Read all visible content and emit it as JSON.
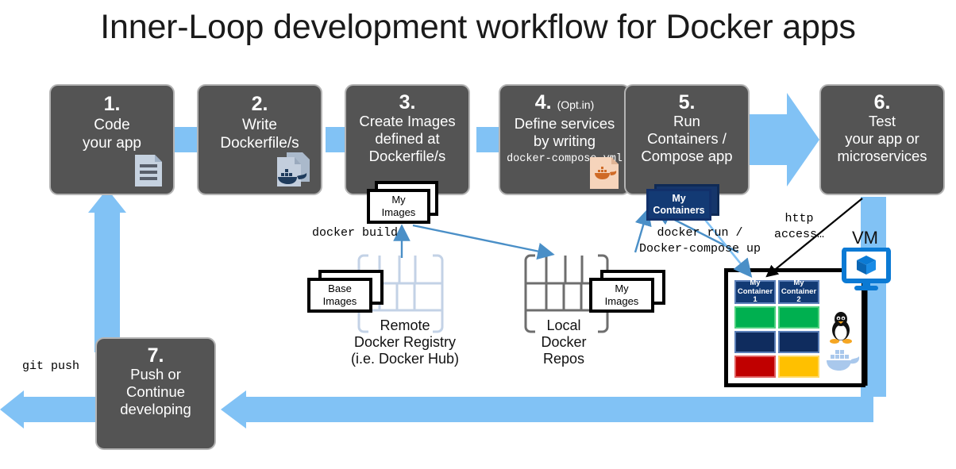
{
  "title": "Inner-Loop development workflow for Docker apps",
  "steps": [
    {
      "num": "1.",
      "opt": "",
      "lines": [
        "Code",
        "your app"
      ],
      "mono": "",
      "icon": "document-icon"
    },
    {
      "num": "2.",
      "opt": "",
      "lines": [
        "Write",
        "Dockerfile/s"
      ],
      "mono": "",
      "icon": "dockerfile-icon"
    },
    {
      "num": "3.",
      "opt": "",
      "lines": [
        "Create Images",
        "defined at",
        "Dockerfile/s"
      ],
      "mono": "",
      "icon": ""
    },
    {
      "num": "4.",
      "opt": "(Opt.in)",
      "lines": [
        "Define services",
        "by writing"
      ],
      "mono": "docker-compose.yml",
      "icon": "compose-file-icon"
    },
    {
      "num": "5.",
      "opt": "",
      "lines": [
        "Run",
        "Containers /",
        "Compose app"
      ],
      "mono": "",
      "icon": ""
    },
    {
      "num": "6.",
      "opt": "",
      "lines": [
        "Test",
        "your app or",
        "microservices"
      ],
      "mono": "",
      "icon": ""
    },
    {
      "num": "7.",
      "opt": "",
      "lines": [
        "Push or",
        "Continue",
        "developing"
      ],
      "mono": "",
      "icon": ""
    }
  ],
  "artifacts": {
    "my_images_build": {
      "line1": "My",
      "line2": "Images"
    },
    "base_images": {
      "line1": "Base",
      "line2": "Images"
    },
    "my_images_local": {
      "line1": "My",
      "line2": "Images"
    },
    "my_containers": {
      "line1": "My",
      "line2": "Containers"
    }
  },
  "captions": {
    "docker_build": "docker build",
    "docker_run": "docker run /\nDocker-compose up",
    "git_push": "git push",
    "http_access": "http\naccess…",
    "remote_registry": "Remote\nDocker Registry\n(i.e. Docker Hub)",
    "local_repos": "Local\nDocker\nRepos",
    "vm": "VM"
  },
  "vm": {
    "containers": [
      {
        "name_line1": "My",
        "name_line2": "Container 1",
        "layers": [
          "#123a74",
          "#00b050",
          "#0f2c5e",
          "#c00000"
        ]
      },
      {
        "name_line1": "My",
        "name_line2": "Container 2",
        "layers": [
          "#123a74",
          "#00b050",
          "#0f2c5e",
          "#ffc000"
        ]
      }
    ],
    "icons": [
      "linux-penguin-icon",
      "docker-whale-icon",
      "vm-monitor-icon"
    ]
  },
  "colors": {
    "step_fill": "#545454",
    "step_border": "#b4b4b4",
    "flow_blue": "#81c2f5",
    "arrow_blue": "#4a8fc7",
    "container_navy": "#133a74",
    "green": "#00b050",
    "red": "#c00000",
    "yellow": "#ffc000",
    "vm_blue": "#0b7ad4",
    "docker_orange": "#d2691e"
  }
}
